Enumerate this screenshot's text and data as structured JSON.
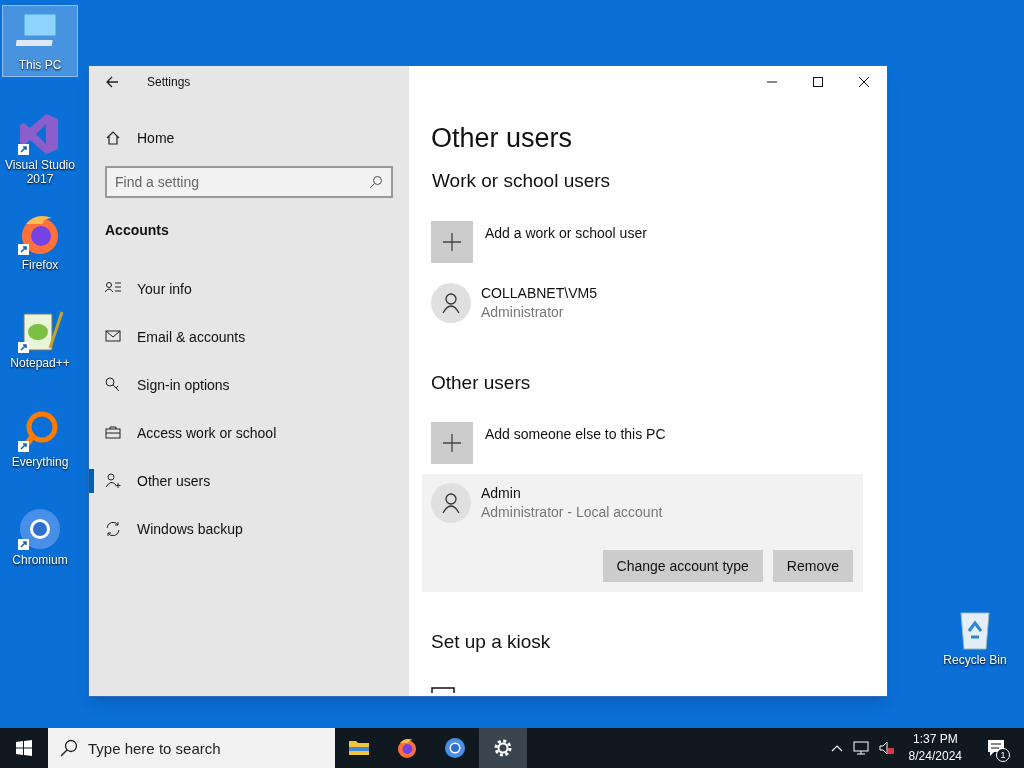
{
  "desktop_icons": [
    {
      "label": "This PC",
      "kind": "pc",
      "selected": true
    },
    {
      "label": "Visual Studio 2017",
      "kind": "vs",
      "selected": false
    },
    {
      "label": "Firefox",
      "kind": "firefox",
      "selected": false
    },
    {
      "label": "Notepad++",
      "kind": "notepad",
      "selected": false
    },
    {
      "label": "Everything",
      "kind": "everything",
      "selected": false
    },
    {
      "label": "Chromium",
      "kind": "chromium",
      "selected": false
    },
    {
      "label": "Recycle Bin",
      "kind": "recycle",
      "selected": false
    }
  ],
  "window": {
    "title": "Settings",
    "sidebar": {
      "home": "Home",
      "search": {
        "placeholder": "Find a setting"
      },
      "section": "Accounts",
      "items": [
        {
          "label": "Your info",
          "kind": "info",
          "selected": false
        },
        {
          "label": "Email & accounts",
          "kind": "mail",
          "selected": false
        },
        {
          "label": "Sign-in options",
          "kind": "key",
          "selected": false
        },
        {
          "label": "Access work or school",
          "kind": "briefcase",
          "selected": false
        },
        {
          "label": "Other users",
          "kind": "useradd",
          "selected": true
        },
        {
          "label": "Windows backup",
          "kind": "sync",
          "selected": false
        }
      ]
    },
    "content": {
      "title": "Other users",
      "work_section": {
        "heading": "Work or school users",
        "add_label": "Add a work or school user",
        "users": [
          {
            "name": "COLLABNET\\VM5",
            "role": "Administrator"
          }
        ]
      },
      "other_section": {
        "heading": "Other users",
        "add_label": "Add someone else to this PC",
        "users": [
          {
            "name": "Admin",
            "role": "Administrator - Local account",
            "expanded": true,
            "buttons": [
              "Change account type",
              "Remove"
            ]
          }
        ]
      },
      "kiosk_section": {
        "heading": "Set up a kiosk"
      }
    }
  },
  "taskbar": {
    "search": {
      "placeholder": "Type here to search"
    },
    "apps": [
      {
        "kind": "explorer",
        "selected": false
      },
      {
        "kind": "firefox",
        "selected": false
      },
      {
        "kind": "chromium",
        "selected": false
      },
      {
        "kind": "settings",
        "selected": true
      }
    ],
    "time": "1:37 PM",
    "date": "8/24/2024",
    "notifications": "1"
  }
}
